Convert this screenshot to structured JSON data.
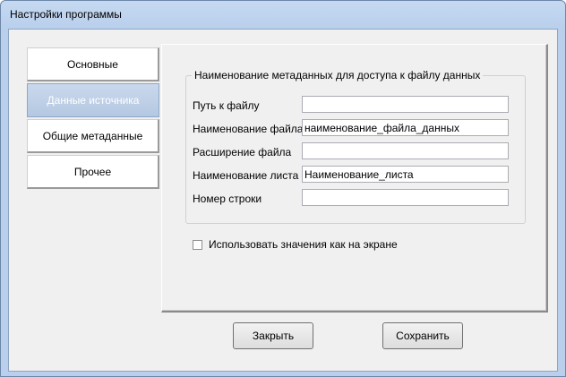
{
  "window": {
    "title": "Настройки программы"
  },
  "tabs": [
    {
      "label": "Основные",
      "selected": false
    },
    {
      "label": "Данные источника",
      "selected": true
    },
    {
      "label": "Общие метаданные",
      "selected": false
    },
    {
      "label": "Прочее",
      "selected": false
    }
  ],
  "group": {
    "title": "Наименование метаданных для доступа к файлу данных",
    "fields": [
      {
        "label": "Путь к файлу",
        "value": ""
      },
      {
        "label": "Наименование файла",
        "value": "наименование_файла_данных"
      },
      {
        "label": "Расширение файла",
        "value": ""
      },
      {
        "label": "Наименование листа",
        "value": "Наименование_листа"
      },
      {
        "label": "Номер строки",
        "value": ""
      }
    ]
  },
  "checkbox": {
    "label": "Использовать значения как на экране",
    "checked": false
  },
  "buttons": {
    "close": "Закрыть",
    "save": "Сохранить"
  },
  "colors": {
    "title_bar": "#b9cfec",
    "selected_tab": "#b4c8e2"
  }
}
